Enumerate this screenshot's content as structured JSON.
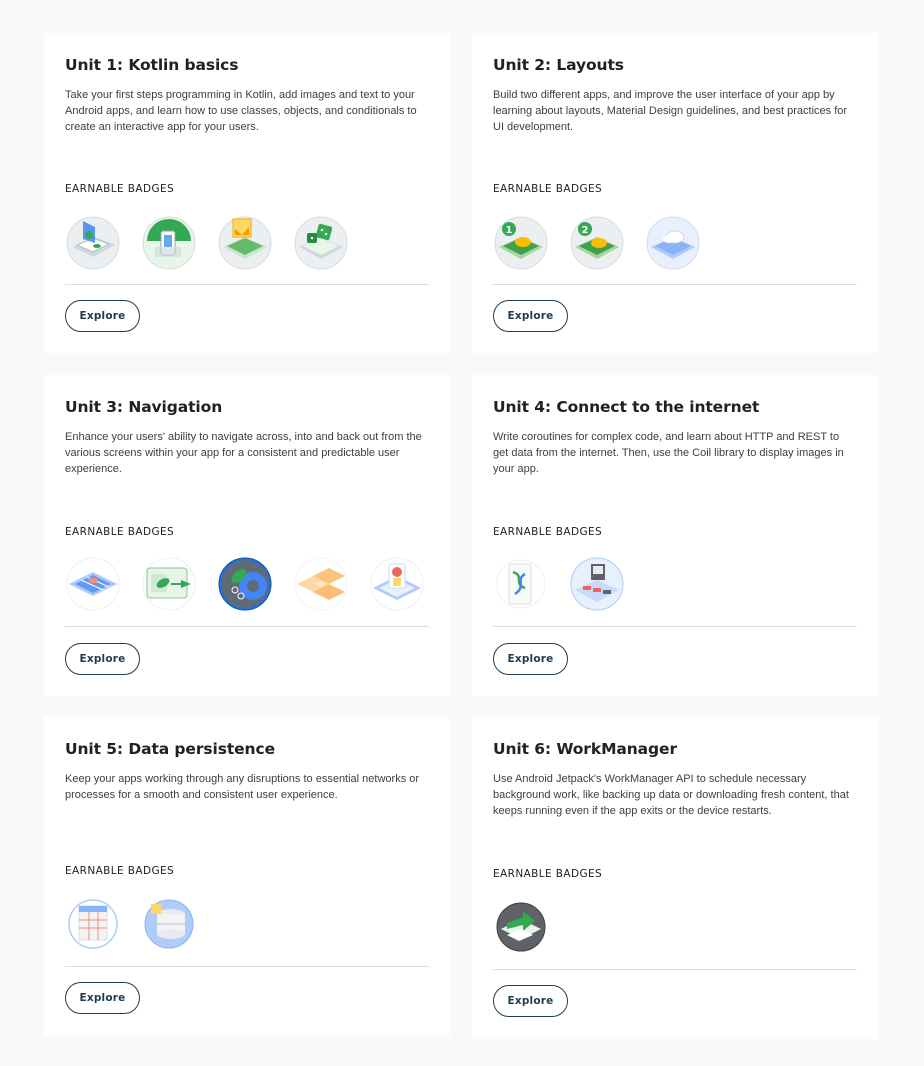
{
  "units": [
    {
      "title": "Unit 1: Kotlin basics",
      "description": "Take your first steps programming in Kotlin, add images and text to your Android apps, and learn how to use classes, objects, and conditionals to create an interactive app for your users.",
      "badges_label": "EARNABLE BADGES",
      "badges": [
        "laptop-badge-icon",
        "phone-badge-icon",
        "image-card-badge-icon",
        "dice-badge-icon"
      ],
      "button": "Explore"
    },
    {
      "title": "Unit 2: Layouts",
      "description": "Build two different apps, and improve the user interface of your app by learning about layouts, Material Design guidelines, and best practices for UI development.",
      "badges_label": "EARNABLE BADGES",
      "badges": [
        "layout-step-1-badge-icon",
        "layout-step-2-badge-icon",
        "material-cloud-badge-icon"
      ],
      "badge_numbers": [
        "1",
        "2"
      ],
      "button": "Explore"
    },
    {
      "title": "Unit 3: Navigation",
      "description": "Enhance your users' ability to navigate across, into and back out from the various screens within your app for a consistent and predictable user experience.",
      "badges_label": "EARNABLE BADGES",
      "badges": [
        "navigation-grid-badge-icon",
        "fragment-flow-badge-icon",
        "lifecycle-gear-badge-icon",
        "cupcake-tiles-badge-icon",
        "screen-flow-badge-icon"
      ],
      "button": "Explore"
    },
    {
      "title": "Unit 4: Connect to the internet",
      "description": "Write coroutines for complex code, and learn about HTTP and REST to get data from the internet. Then, use the Coil library to display images in your app.",
      "badges_label": "EARNABLE BADGES",
      "badges": [
        "coroutines-badge-icon",
        "internet-images-badge-icon"
      ],
      "button": "Explore"
    },
    {
      "title": "Unit 5: Data persistence",
      "description": "Keep your apps working through any disruptions to essential networks or processes for a smooth and consistent user experience.",
      "badges_label": "EARNABLE BADGES",
      "badges": [
        "sql-table-badge-icon",
        "database-badge-icon"
      ],
      "button": "Explore"
    },
    {
      "title": "Unit 6: WorkManager",
      "description": "Use Android Jetpack's WorkManager API to schedule necessary background work, like backing up data or downloading fresh content, that keeps running even if the app exits or the device restarts.",
      "badges_label": "EARNABLE BADGES",
      "badges": [
        "workmanager-badge-icon"
      ],
      "button": "Explore"
    }
  ]
}
